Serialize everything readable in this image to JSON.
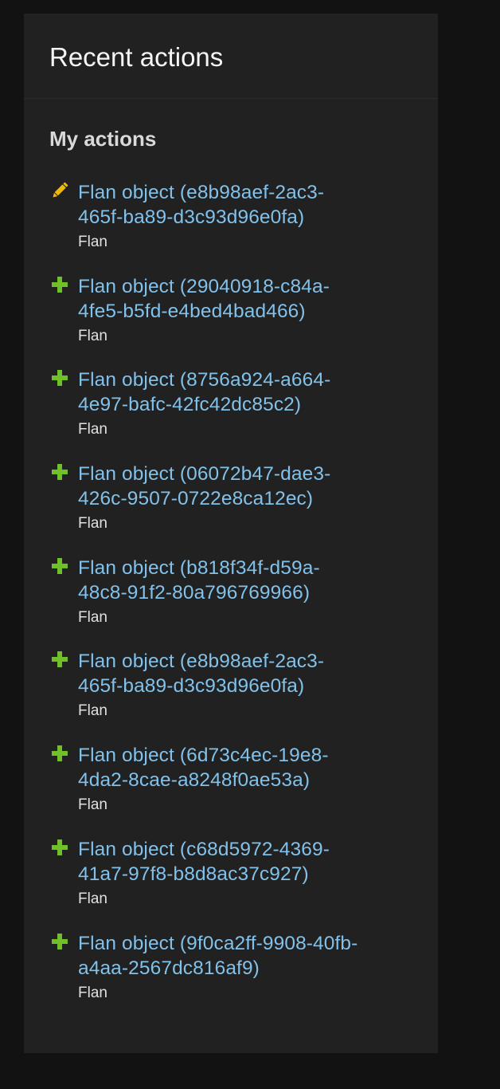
{
  "module": {
    "title": "Recent actions",
    "section_title": "My actions"
  },
  "actions": [
    {
      "type": "change",
      "icon": "pencil-icon",
      "line1": "Flan object (e8b98aef-2ac3-",
      "line2": "465f-ba89-d3c93d96e0fa)",
      "content_type": "Flan"
    },
    {
      "type": "add",
      "icon": "plus-icon",
      "line1": "Flan object (29040918-c84a-",
      "line2": "4fe5-b5fd-e4bed4bad466)",
      "content_type": "Flan"
    },
    {
      "type": "add",
      "icon": "plus-icon",
      "line1": "Flan object (8756a924-a664-",
      "line2": "4e97-bafc-42fc42dc85c2)",
      "content_type": "Flan"
    },
    {
      "type": "add",
      "icon": "plus-icon",
      "line1": "Flan object (06072b47-dae3-",
      "line2": "426c-9507-0722e8ca12ec)",
      "content_type": "Flan"
    },
    {
      "type": "add",
      "icon": "plus-icon",
      "line1": "Flan object (b818f34f-d59a-",
      "line2": "48c8-91f2-80a796769966)",
      "content_type": "Flan"
    },
    {
      "type": "add",
      "icon": "plus-icon",
      "line1": "Flan object (e8b98aef-2ac3-",
      "line2": "465f-ba89-d3c93d96e0fa)",
      "content_type": "Flan"
    },
    {
      "type": "add",
      "icon": "plus-icon",
      "line1": "Flan object (6d73c4ec-19e8-",
      "line2": "4da2-8cae-a8248f0ae53a)",
      "content_type": "Flan"
    },
    {
      "type": "add",
      "icon": "plus-icon",
      "line1": "Flan object (c68d5972-4369-",
      "line2": "41a7-97f8-b8d8ac37c927)",
      "content_type": "Flan"
    },
    {
      "type": "add",
      "icon": "plus-icon",
      "line1": "Flan object (9f0ca2ff-9908-40fb-",
      "line2": "a4aa-2567dc816af9)",
      "content_type": "Flan"
    }
  ],
  "colors": {
    "background": "#121212",
    "module": "#212121",
    "link": "#81c1ea",
    "add_icon": "#70bf2b",
    "change_icon": "#efb80b"
  }
}
